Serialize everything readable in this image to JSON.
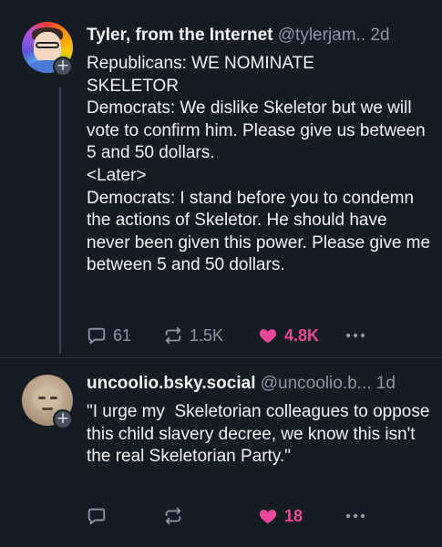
{
  "colors": {
    "background": "#151b23",
    "text": "#f1f3f5",
    "muted": "#8a96a3",
    "like_accent": "#ec4899"
  },
  "posts": [
    {
      "display_name": "Tyler, from the Internet",
      "handle": "@tylerjam..",
      "time": "2d",
      "avatar_icon": "avatar-rainbow-cartoon",
      "body": "Republicans: WE NOMINATE\nSKELETOR\nDemocrats: We dislike Skeletor but we will vote to confirm him. Please give us between 5 and 50 dollars.\n<Later>\nDemocrats: I stand before you to condemn the actions of Skeletor. He should have never been given this power. Please give me between 5 and 50 dollars.",
      "replies": "61",
      "reposts": "1.5K",
      "likes": "4.8K",
      "liked": true
    },
    {
      "display_name": "uncoolio.bsky.social",
      "handle": "@uncoolio.b...",
      "time": "1d",
      "avatar_icon": "avatar-mask",
      "body": "\"I urge my  Skeletorian colleagues to oppose this child slavery decree, we know this isn't the real Skeletorian Party.\"",
      "replies": "",
      "reposts": "",
      "likes": "18",
      "liked": true
    }
  ],
  "icons": {
    "reply": "speech-bubble-icon",
    "repost": "repost-arrows-icon",
    "like": "heart-icon",
    "more": "ellipsis-icon",
    "follow": "plus-icon"
  },
  "follow_badge": "+"
}
